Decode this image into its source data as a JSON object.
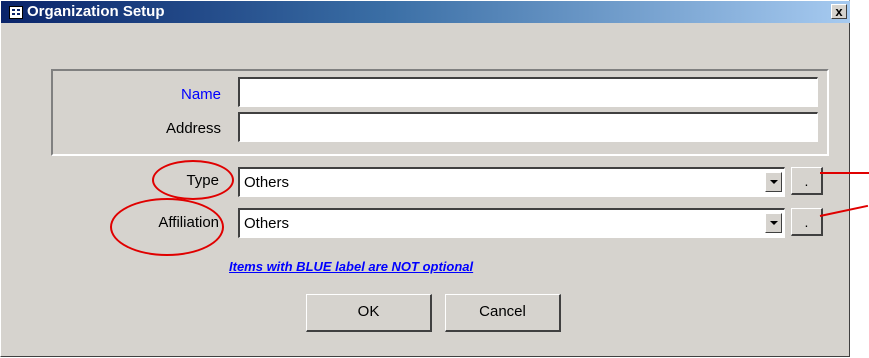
{
  "window": {
    "title": "Organization Setup",
    "close_label": "x"
  },
  "form": {
    "name_label": "Name",
    "name_value": "",
    "address_label": "Address",
    "address_value": "",
    "type_label": "Type",
    "type_value": "Others",
    "type_more_label": ".",
    "affiliation_label": "Affiliation",
    "affiliation_value": "Others",
    "affiliation_more_label": ".",
    "note": "Items with BLUE label are NOT optional"
  },
  "buttons": {
    "ok": "OK",
    "cancel": "Cancel"
  },
  "colors": {
    "required_label": "#0000ff",
    "annotation": "#e00000"
  },
  "icons": [
    "app-icon",
    "close-icon",
    "dropdown-arrow-icon"
  ]
}
